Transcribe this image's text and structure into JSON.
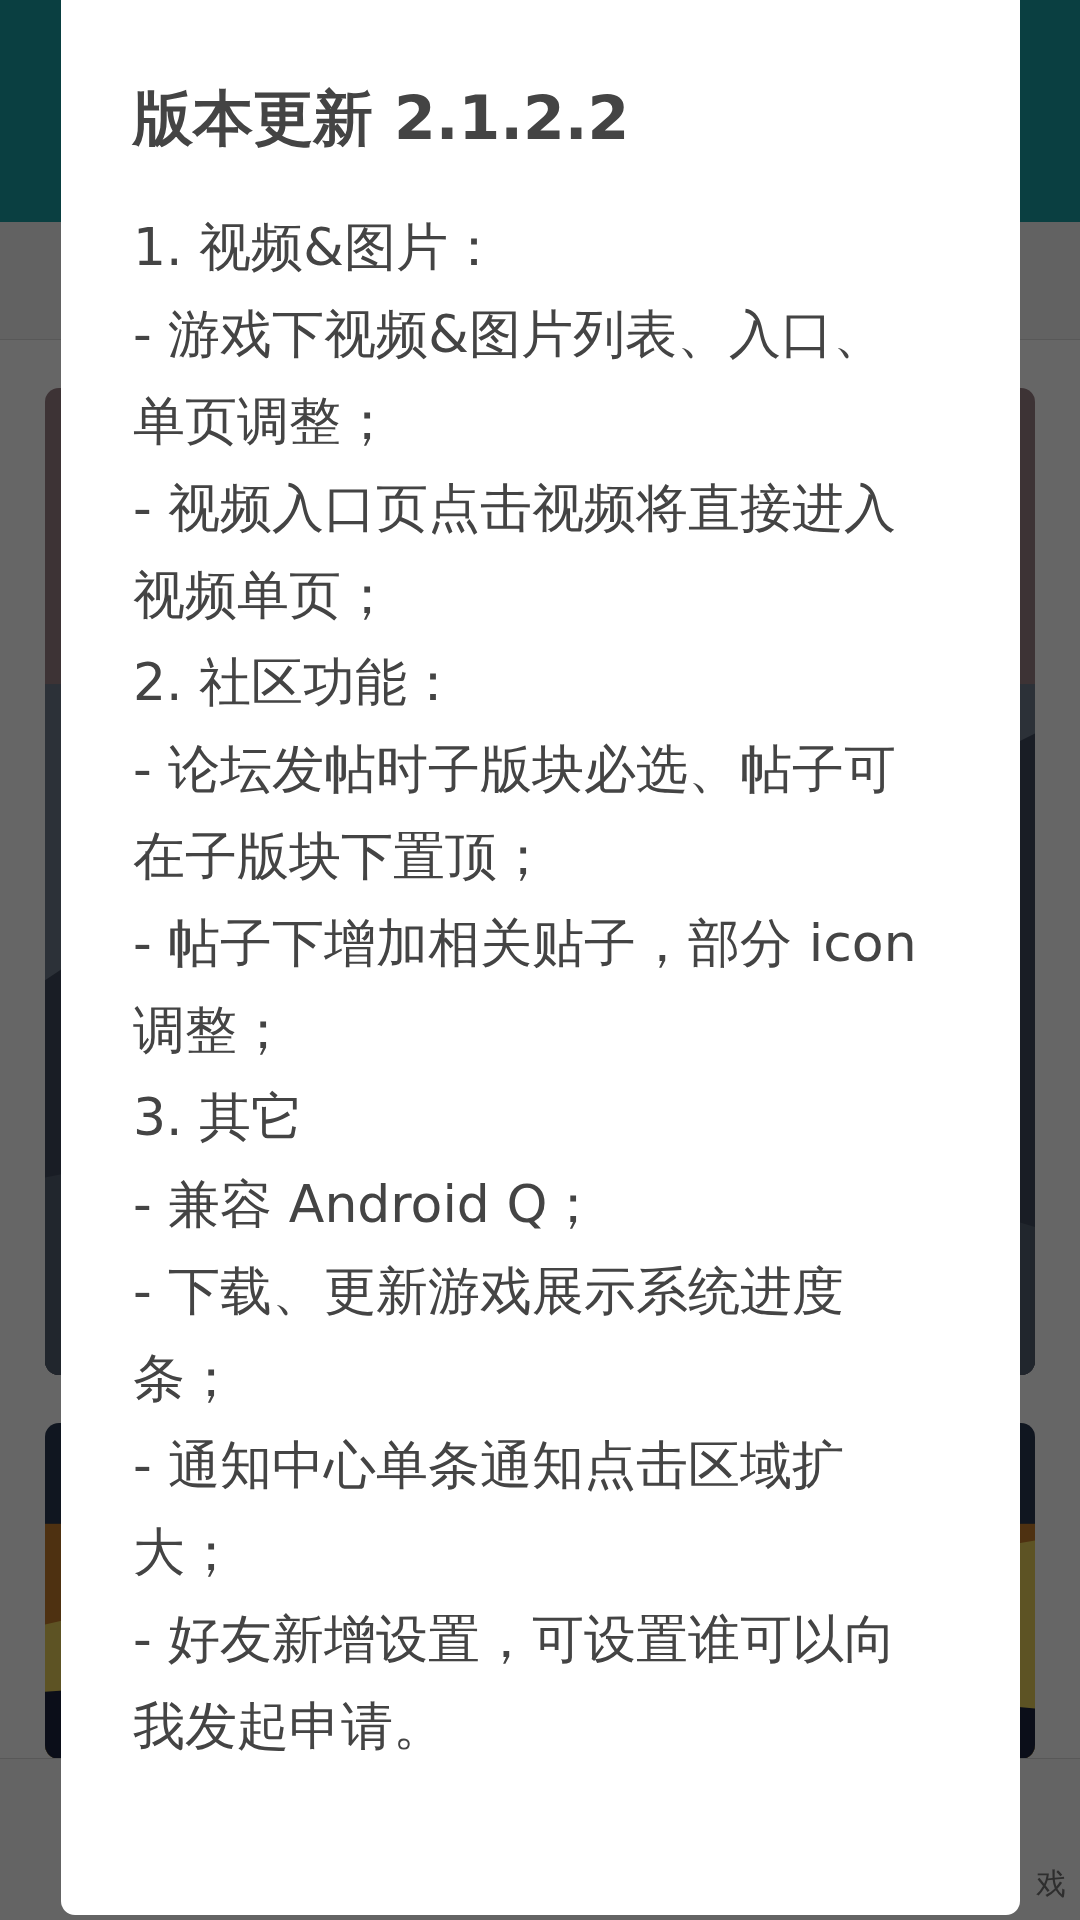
{
  "background": {
    "bottom_nav": {
      "label": "戏"
    }
  },
  "dialog": {
    "title": "版本更新 2.1.2.2",
    "lines": [
      "1. 视频&图片：",
      "- 游戏下视频&图片列表、入口、单页调整；",
      "- 视频入口页点击视频将直接进入视频单页；",
      "2. 社区功能：",
      "- 论坛发帖时子版块必选、帖子可在子版块下置顶；",
      "- 帖子下增加相关贴子，部分 icon 调整；",
      "3. 其它",
      "- 兼容 Android Q；",
      "- 下载、更新游戏展示系统进度条；",
      "- 通知中心单条通知点击区域扩大；",
      "- 好友新增设置，可设置谁可以向我发起申请。"
    ]
  }
}
